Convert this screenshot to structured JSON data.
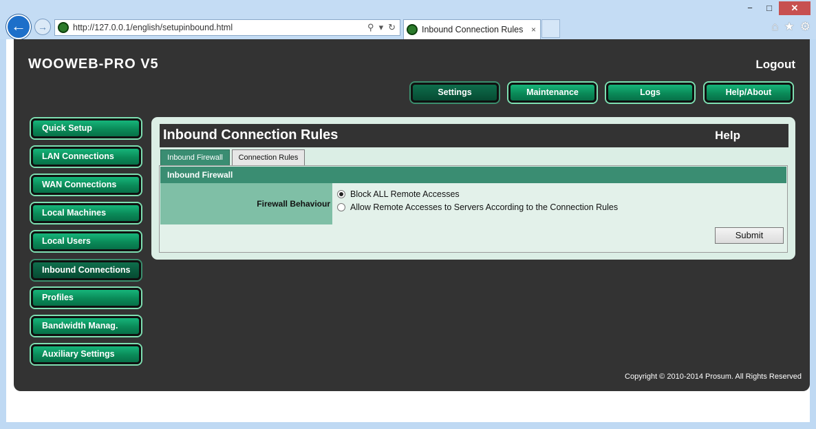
{
  "browser": {
    "url": "http://127.0.0.1/english/setupinbound.html",
    "tab_title": "Inbound Connection Rules",
    "window_buttons": {
      "minimize": "−",
      "maximize": "□",
      "close": "✕"
    },
    "nav": {
      "back": "←",
      "forward": "→"
    },
    "addr_icons": {
      "search": "⚲",
      "dropdown": "▾",
      "refresh": "↻"
    },
    "tab_close": "×",
    "tools": {
      "home": "⌂",
      "favorites": "★",
      "settings": "⚙"
    }
  },
  "app": {
    "brand": "WOOWEB-PRO V5",
    "logout": "Logout",
    "top_nav": [
      "Settings",
      "Maintenance",
      "Logs",
      "Help/About"
    ],
    "sidebar": [
      "Quick Setup",
      "LAN Connections",
      "WAN Connections",
      "Local Machines",
      "Local Users",
      "Inbound Connections",
      "Profiles",
      "Bandwidth Manag.",
      "Auxiliary Settings"
    ],
    "panel": {
      "title": "Inbound Connection Rules",
      "help": "Help",
      "tabs": [
        "Inbound Firewall",
        "Connection Rules"
      ],
      "section_title": "Inbound Firewall",
      "field_label": "Firewall Behaviour",
      "options": [
        "Block ALL Remote Accesses",
        "Allow Remote Accesses to Servers According to the Connection Rules"
      ],
      "submit": "Submit"
    },
    "copyright": "Copyright © 2010-2014 Prosum. All Rights Reserved"
  }
}
